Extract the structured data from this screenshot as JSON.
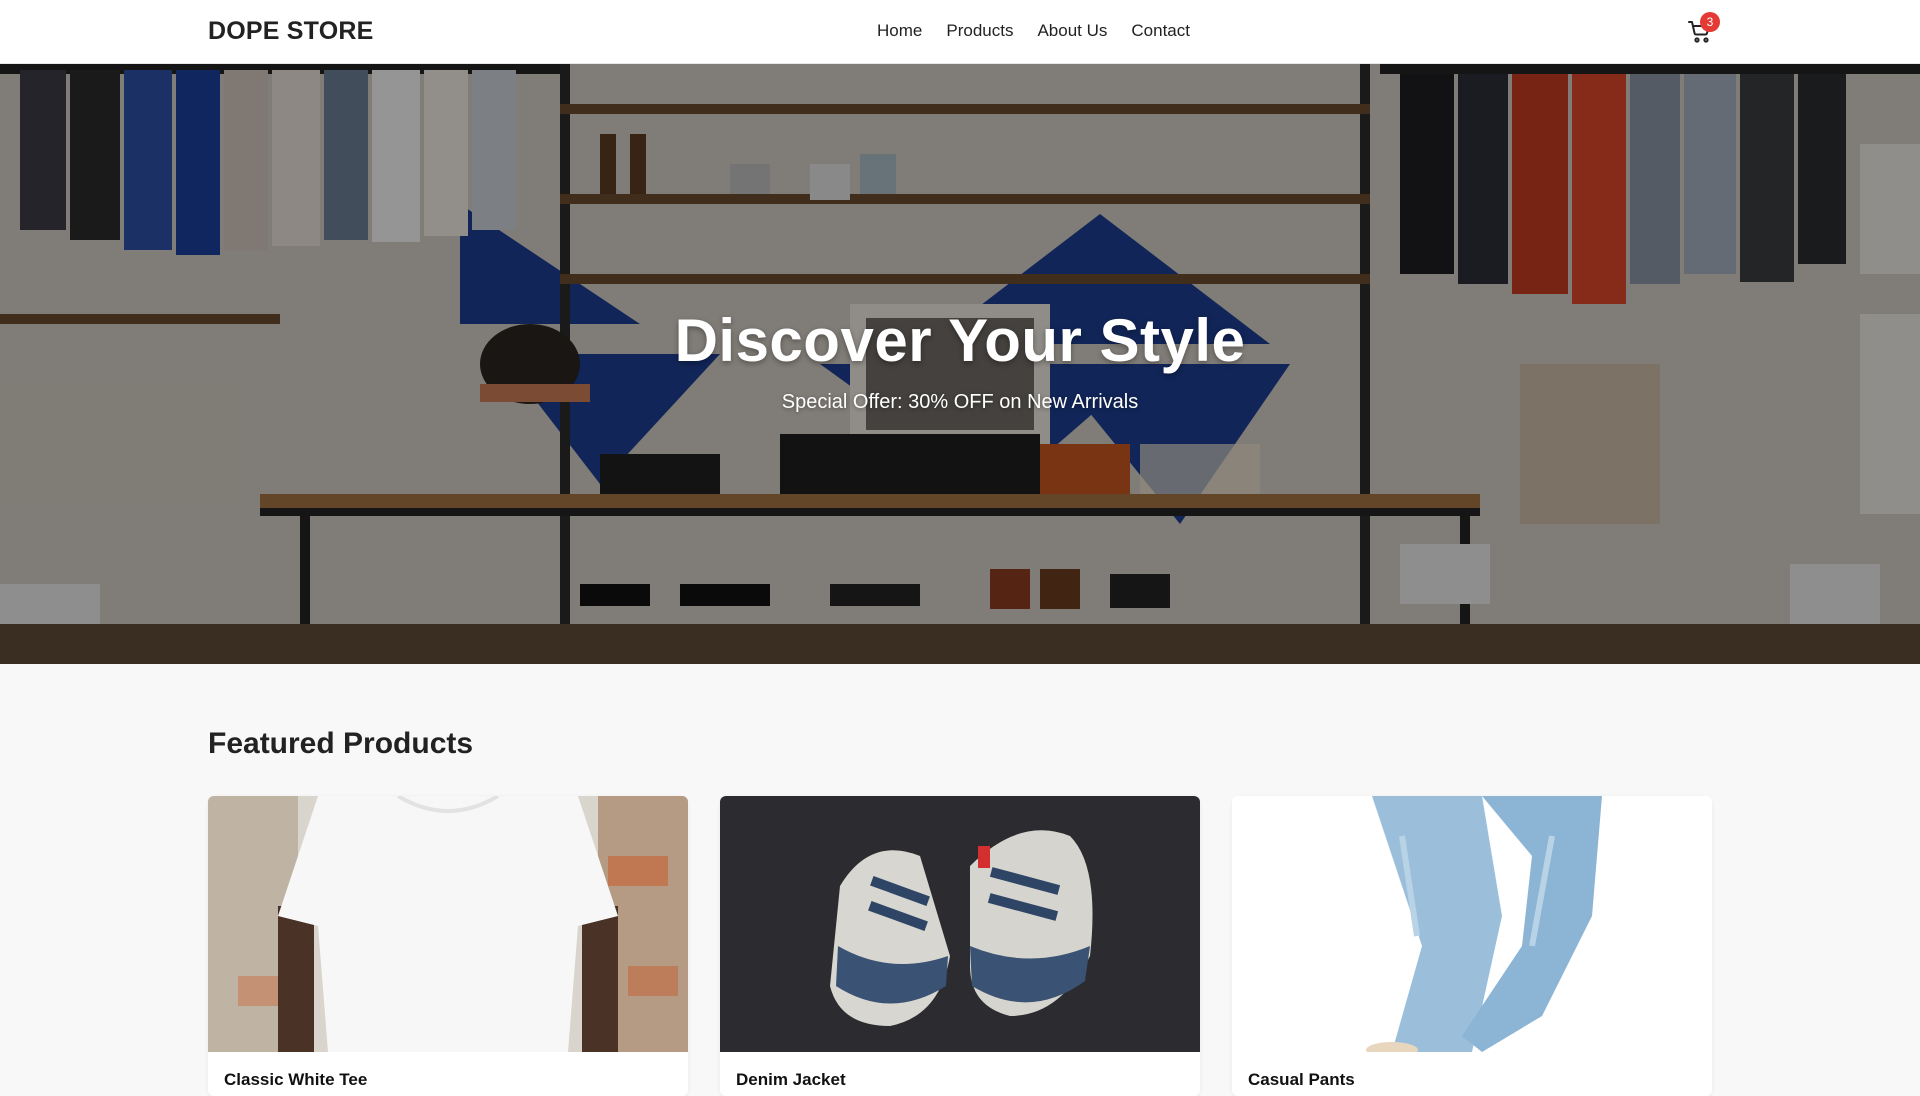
{
  "navbar": {
    "brand": "DOPE STORE",
    "links": [
      "Home",
      "Products",
      "About Us",
      "Contact"
    ],
    "cart_icon": "shopping-cart-icon",
    "cart_count": "3"
  },
  "hero": {
    "title": "Discover Your Style",
    "subtitle": "Special Offer: 30% OFF on New Arrivals"
  },
  "featured": {
    "title": "Featured Products",
    "products": [
      {
        "name": "Classic White Tee"
      },
      {
        "name": "Denim Jacket"
      },
      {
        "name": "Casual Pants"
      }
    ]
  },
  "colors": {
    "navbar_bg": "#ffffff",
    "badge": "#e53935",
    "page_bg": "#f8f8f8",
    "text": "#222222"
  }
}
